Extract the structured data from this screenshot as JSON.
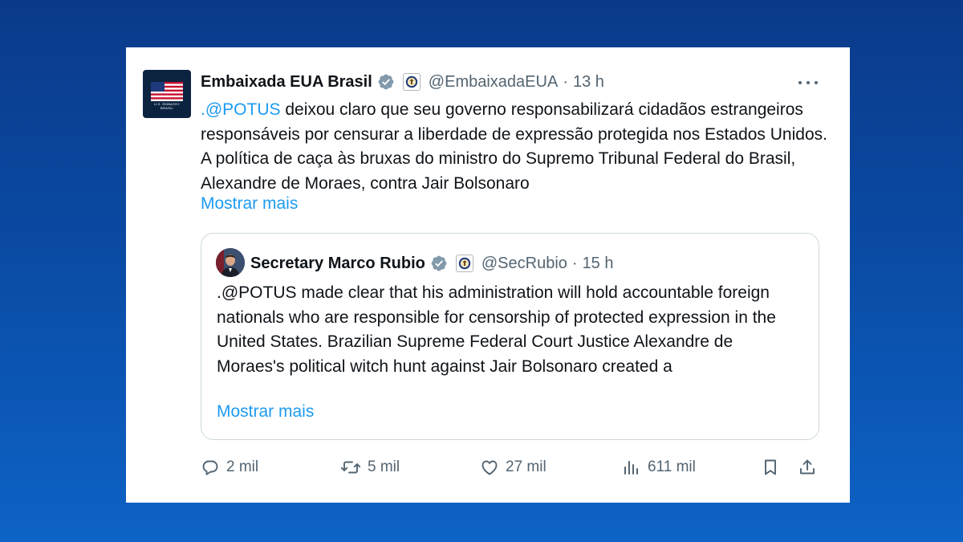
{
  "tweet": {
    "avatar_caption": "U.S. EMBASSY",
    "avatar_caption_sub": "BRASIL",
    "author_name": "Embaixada EUA Brasil",
    "handle": "@EmbaixadaEUA",
    "separator": "·",
    "time": "13 h",
    "text_mention": ".@POTUS",
    "text_body": " deixou claro que seu governo responsabilizará cidadãos estrangeiros responsáveis por censurar a liberdade de expressão protegida nos Estados Unidos. A política de caça às bruxas do ministro do Supremo Tribunal Federal do Brasil, Alexandre de Moraes, contra Jair Bolsonaro",
    "show_more": "Mostrar mais"
  },
  "quote": {
    "author_name": "Secretary Marco Rubio",
    "handle": "@SecRubio",
    "separator": "·",
    "time": "15 h",
    "text": ".@POTUS made clear that his administration will hold accountable foreign nationals who are responsible for censorship of protected expression in the United States. Brazilian Supreme Federal Court Justice Alexandre de Moraes's political witch hunt against Jair Bolsonaro created a",
    "show_more": "Mostrar mais"
  },
  "actions": {
    "replies": "2 mil",
    "retweets": "5 mil",
    "likes": "27 mil",
    "views": "611 mil"
  },
  "icons": {
    "verified": "verified-badge-icon",
    "seal": "government-seal-icon",
    "more": "more-options-icon",
    "reply": "reply-icon",
    "retweet": "retweet-icon",
    "like": "heart-icon",
    "views": "views-icon",
    "bookmark": "bookmark-icon",
    "share": "share-icon"
  },
  "colors": {
    "link": "#1d9bf0",
    "verified": "#829aab",
    "muted": "#536471",
    "text": "#0f1419",
    "background_top": "#0b3a8a",
    "background_bottom": "#0d63c6"
  }
}
